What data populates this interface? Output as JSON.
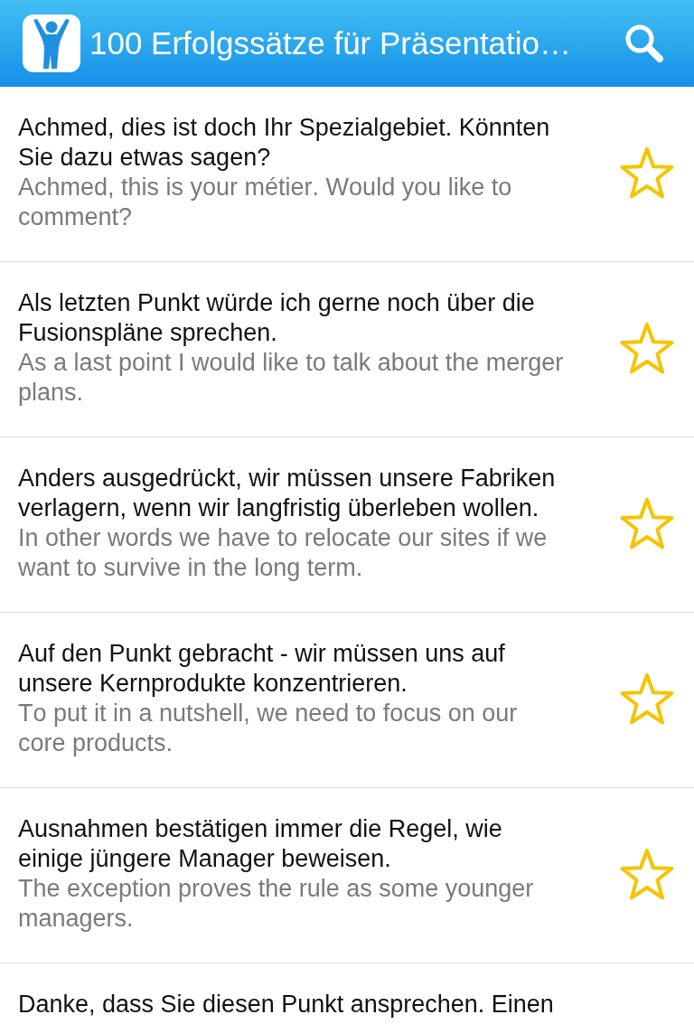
{
  "app_bar": {
    "title": "100 Erfolgssätze für Präsentatio…"
  },
  "items": [
    {
      "german": "Achmed, dies ist doch Ihr Spezialgebiet. Könnten Sie dazu etwas sagen?",
      "english": "Achmed, this is your métier. Would you like to comment?",
      "starred": false
    },
    {
      "german": "Als letzten Punkt würde ich gerne noch über die Fusionspläne sprechen.",
      "english": "As a last point I would like to talk about the merger plans.",
      "starred": false
    },
    {
      "german": "Anders ausgedrückt, wir müssen unsere Fabriken verlagern, wenn wir langfristig überleben wollen.",
      "english": "In other words we have to relocate our sites if we want to survive in the long term.",
      "starred": false
    },
    {
      "german": "Auf den Punkt gebracht - wir müssen uns auf unsere Kernprodukte konzentrieren.",
      "english": "To put it in a nutshell, we need to focus on our core products.",
      "starred": false
    },
    {
      "german": "Ausnahmen bestätigen immer die Regel, wie einige jüngere Manager beweisen.",
      "english": "The exception proves the rule as some younger managers.",
      "starred": false
    },
    {
      "german": "Danke, dass Sie diesen Punkt ansprechen. Einen"
    }
  ]
}
